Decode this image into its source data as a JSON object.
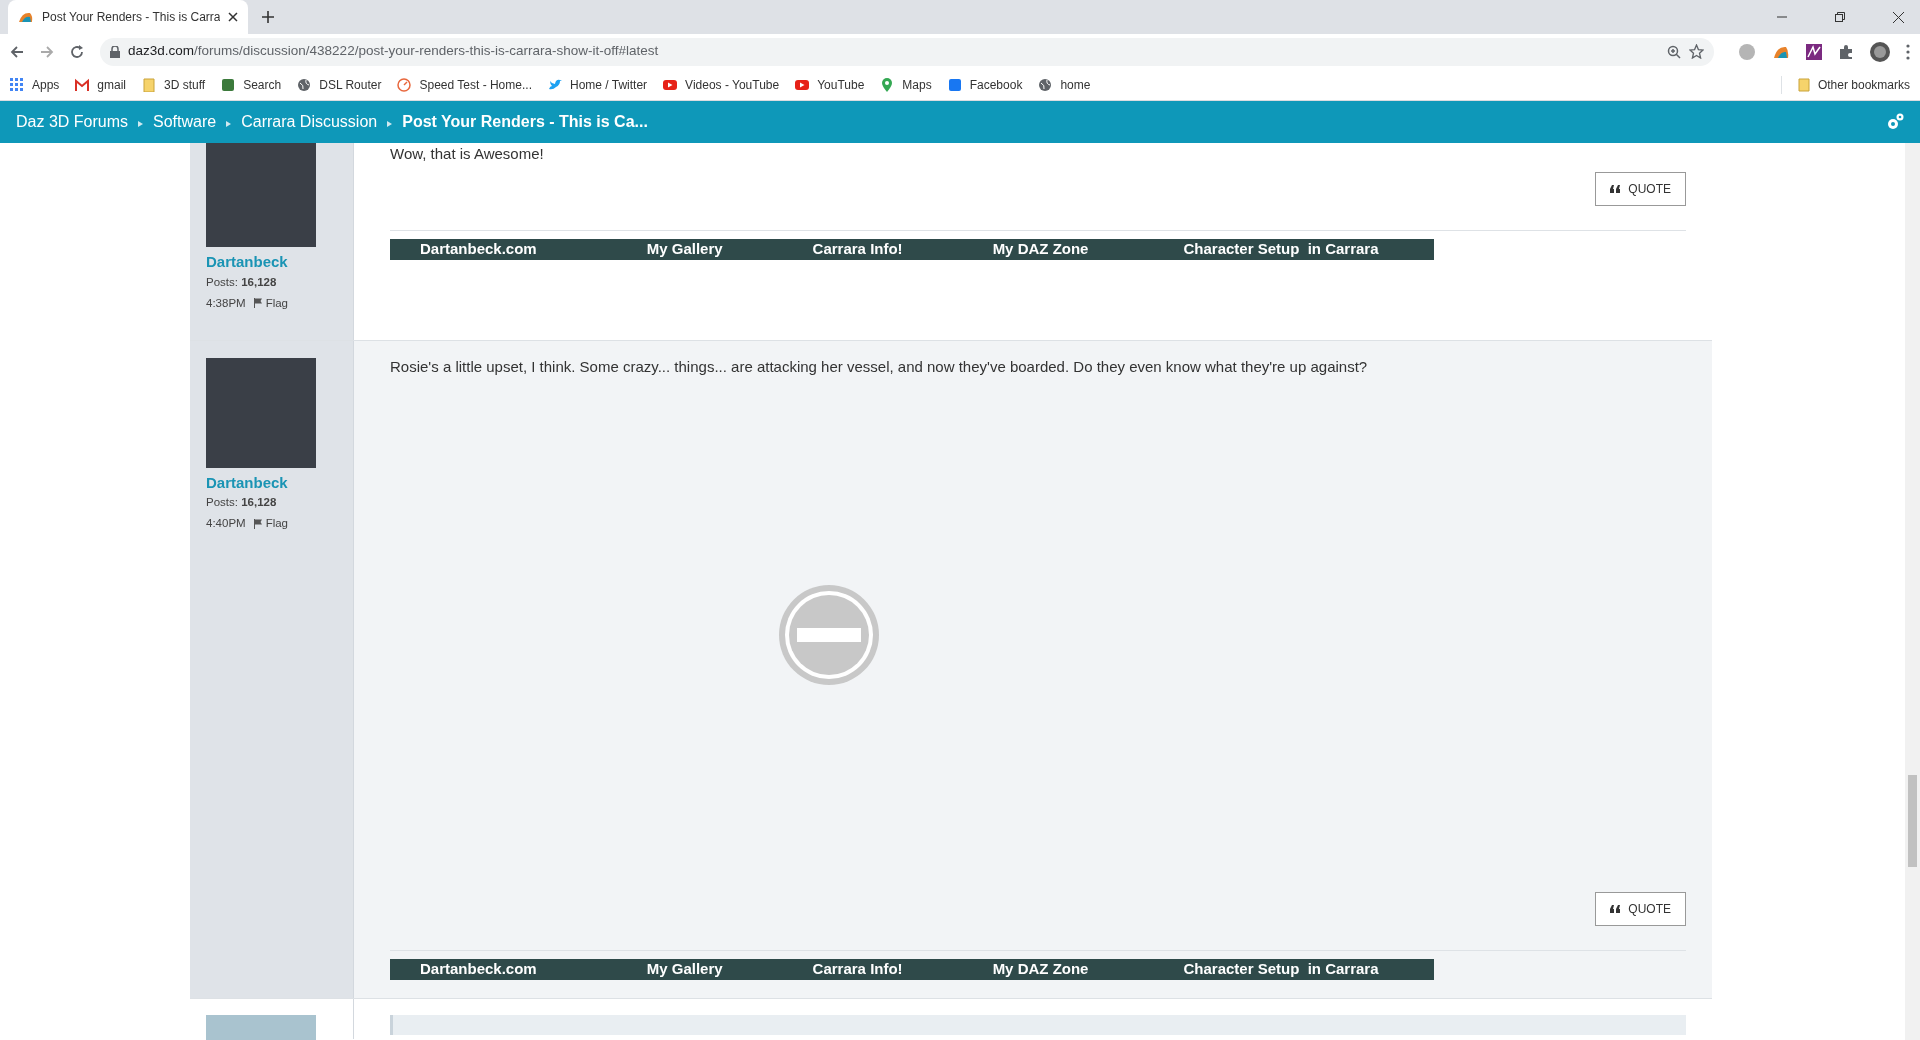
{
  "browser": {
    "tab_title": "Post Your Renders - This is Carra",
    "url_host": "daz3d.com",
    "url_path": "/forums/discussion/438222/post-your-renders-this-is-carrara-show-it-off#latest",
    "bookmarks": [
      {
        "label": "Apps",
        "kind": "apps",
        "color": "#4285f4"
      },
      {
        "label": "gmail",
        "kind": "mail",
        "color": "#d93025"
      },
      {
        "label": "3D stuff",
        "kind": "folder",
        "color": "#f6d36b"
      },
      {
        "label": "Search",
        "kind": "site",
        "color": "#3c7a3c"
      },
      {
        "label": "DSL Router",
        "kind": "globe",
        "color": "#5f6368"
      },
      {
        "label": "Speed Test - Home...",
        "kind": "gauge",
        "color": "#e8673c"
      },
      {
        "label": "Home / Twitter",
        "kind": "bird",
        "color": "#1da1f2"
      },
      {
        "label": "Videos - YouTube",
        "kind": "play",
        "color": "#e62117"
      },
      {
        "label": "YouTube",
        "kind": "play",
        "color": "#e62117"
      },
      {
        "label": "Maps",
        "kind": "pin",
        "color": "#34a853"
      },
      {
        "label": "Facebook",
        "kind": "site",
        "color": "#1877f2"
      },
      {
        "label": "home",
        "kind": "globe",
        "color": "#5f6368"
      }
    ],
    "other_bookmarks": "Other bookmarks"
  },
  "breadcrumbs": [
    {
      "label": "Daz 3D Forums",
      "selected": false
    },
    {
      "label": "Software",
      "selected": false
    },
    {
      "label": "Carrara Discussion",
      "selected": false
    },
    {
      "label": "Post Your Renders - This is Ca...",
      "selected": true
    }
  ],
  "posts": [
    {
      "author": "Dartanbeck",
      "posts_label": "Posts:",
      "posts_count": "16,128",
      "time": "4:38PM",
      "flag": "Flag",
      "body": "Wow, that is Awesome!",
      "image_blocked": false,
      "quote": "QUOTE",
      "signature": [
        "Dartanbeck.com",
        "My Gallery",
        "Carrara Info!",
        "My DAZ Zone",
        "Character Setup  in Carrara"
      ]
    },
    {
      "author": "Dartanbeck",
      "posts_label": "Posts:",
      "posts_count": "16,128",
      "time": "4:40PM",
      "flag": "Flag",
      "body": "Rosie's a little upset, I think. Some crazy... things... are attacking her vessel, and now they've boarded. Do they even know what they're up against?",
      "image_blocked": true,
      "quote": "QUOTE",
      "signature": [
        "Dartanbeck.com",
        "My Gallery",
        "Carrara Info!",
        "My DAZ Zone",
        "Character Setup  in Carrara"
      ]
    }
  ]
}
